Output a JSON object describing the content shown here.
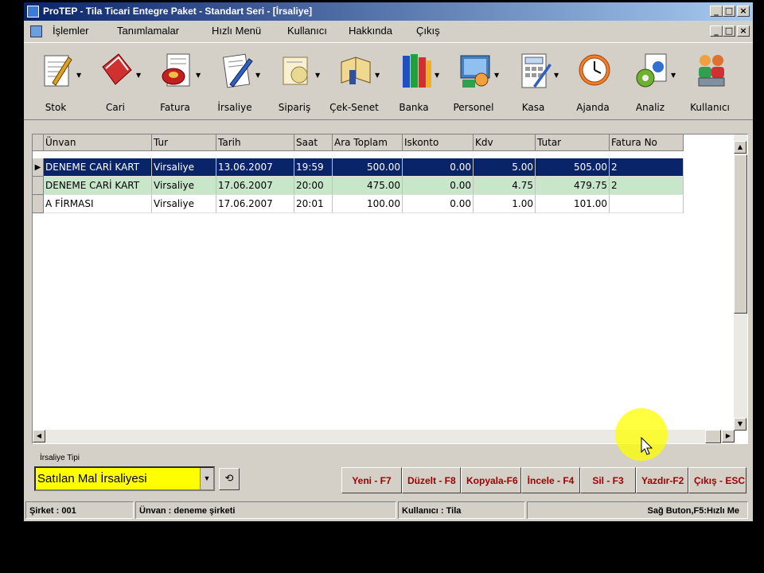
{
  "window": {
    "title": "ProTEP - Tila Ticari Entegre Paket - Standart Seri - [İrsaliye]",
    "controls": [
      "_",
      "□",
      "×"
    ]
  },
  "menu": [
    "İşlemler",
    "Tanımlamalar",
    "Hızlı Menü",
    "Kullanıcı",
    "Hakkında",
    "Çıkış"
  ],
  "toolbar": [
    {
      "label": "Stok",
      "icon": "stock-icon"
    },
    {
      "label": "Cari",
      "icon": "cari-book-icon"
    },
    {
      "label": "Fatura",
      "icon": "invoice-icon"
    },
    {
      "label": "İrsaliye",
      "icon": "waybill-icon"
    },
    {
      "label": "Sipariş",
      "icon": "order-icon"
    },
    {
      "label": "Çek-Senet",
      "icon": "cheque-icon"
    },
    {
      "label": "Banka",
      "icon": "bank-books-icon"
    },
    {
      "label": "Personel",
      "icon": "personnel-icon"
    },
    {
      "label": "Kasa",
      "icon": "calculator-icon"
    },
    {
      "label": "Ajanda",
      "icon": "clock-icon"
    },
    {
      "label": "Analiz",
      "icon": "analysis-icon"
    },
    {
      "label": "Kullanıcı",
      "icon": "users-icon"
    }
  ],
  "table": {
    "columns": [
      "Ünvan",
      "Tur",
      "Tarih",
      "Saat",
      "Ara Toplam",
      "Iskonto",
      "Kdv",
      "Tutar",
      "Fatura No"
    ],
    "rows": [
      [
        "DENEME CARİ KART",
        "Virsaliye",
        "13.06.2007",
        "19:59",
        "500.00",
        "0.00",
        "5.00",
        "505.00",
        "2"
      ],
      [
        "DENEME CARİ KART",
        "Virsaliye",
        "17.06.2007",
        "20:00",
        "475.00",
        "0.00",
        "4.75",
        "479.75",
        "2"
      ],
      [
        "A FİRMASI",
        "Virsaliye",
        "17.06.2007",
        "20:01",
        "100.00",
        "0.00",
        "1.00",
        "101.00",
        ""
      ]
    ]
  },
  "irsaliye_tipi": {
    "label": "İrsaliye Tipi",
    "value": "Satılan Mal İrsaliyesi"
  },
  "buttons": [
    "Yeni - F7",
    "Düzelt - F8",
    "Kopyala-F6",
    "İncele - F4",
    "Sil - F3",
    "Yazdır-F2",
    "Çıkış - ESC"
  ],
  "status": {
    "sirket": "Şirket : 001",
    "unvan": "Ünvan : deneme şirketi",
    "kullanici": "Kullanıcı : Tila",
    "hint": "Sağ Buton,F5:Hızlı Me"
  },
  "colors": {
    "selected_row": "#0a246a",
    "alt_row": "#c8e6c9",
    "combo_bg": "#ffff00",
    "button_text": "#a00000"
  }
}
